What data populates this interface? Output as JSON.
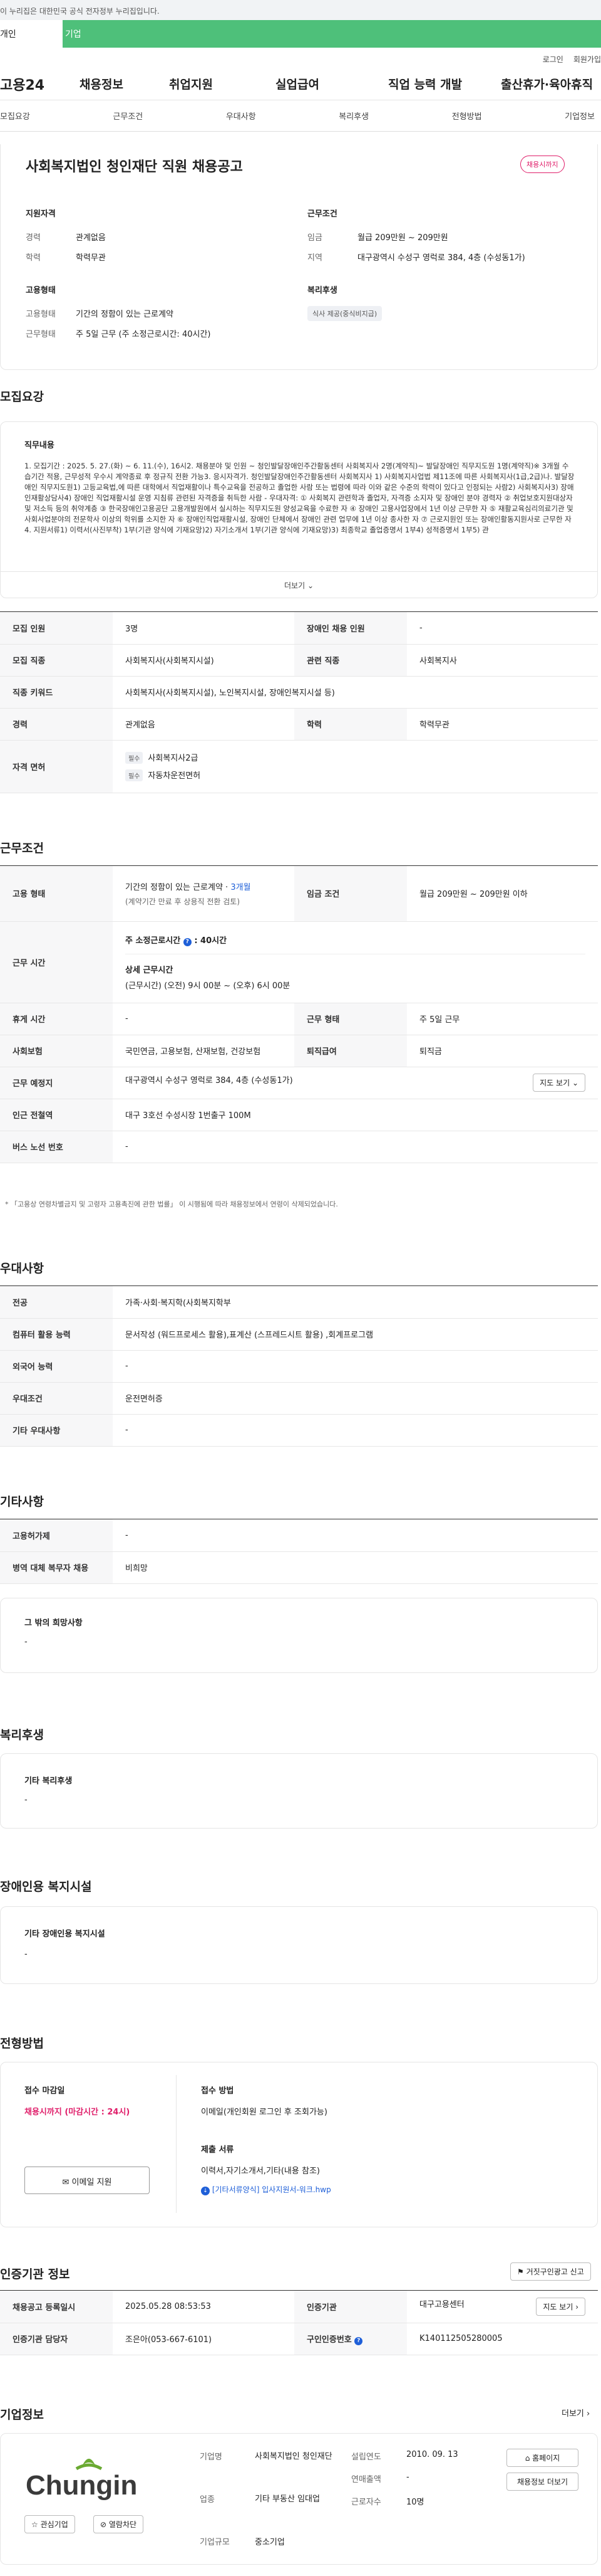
{
  "gov_notice": "이 누리집은 대한민국 공식 전자정부 누리집입니다.",
  "top_tabs": [
    "개인",
    "기업"
  ],
  "util": [
    "로그인",
    "회원가입"
  ],
  "gnb": {
    "logo": "고용24",
    "items": [
      "채용정보",
      "취업지원",
      "실업급여",
      "직업 능력 개발",
      "출산휴가·육아휴직"
    ]
  },
  "subnav": [
    "모집요강",
    "근무조건",
    "우대사항",
    "복리후생",
    "전형방법",
    "기업정보"
  ],
  "job": {
    "title": "사회복지법인 청인재단 직원 채용공고",
    "status": "채용시까지",
    "qual_h": "지원자격",
    "career_l": "경력",
    "career_v": "관계없음",
    "edu_l": "학력",
    "edu_v": "학력무관",
    "cond_h": "근무조건",
    "wage_l": "임금",
    "wage_v": "월급 209만원 ~ 209만원",
    "area_l": "지역",
    "area_v": "대구광역시 수성구 영럭로 384, 4층 (수성동1가)",
    "emp_h": "고용형태",
    "emp_l": "고용형태",
    "emp_v": "기간의 정함이 있는 근로계약",
    "hours_l": "근무형태",
    "hours_v": "주 5일 근무 (주 소정근로시간: 40시간)",
    "welfare_h": "복리후생",
    "welfare_tag": "식사 제공(중식비지급)"
  },
  "recruit": {
    "title": "모집요강",
    "content_h": "직무내용",
    "content": "1. 모집기간 : 2025. 5. 27.(화) ~ 6. 11.(수), 16시2. 채용분야 및 인원 ~ 청인발달장애인주간활동센터 사회복지사 2명(계약직)~ 발달장애인 직무지도원 1명(계약직)※ 3개월 수습기간 적용, 근무성적 우수시 계약종료 후 정규직 전환 가능3. 응시자격가. 청인발달장애인주간활동센터 사회복지사 1) 사회복지사업법 제11조에 따른 사회복지사(1급,2급)나. 발달장애인 직무지도원1) 고등교육법,에 따른 대학에서 직업재활이나 특수교육을 전공하고 졸업한 사람 또는 법령에 따라 이와 같은 수준의 학력이 있다고 인정되는 사람2) 사회복지사3) 장애인재활상담사4) 장애인 직업재활시설 운영 지침류 관련된 자격증을 취득한 사람 - 우대자격: ① 사회복지 관련학과 졸업자, 자격증 소지자 및 장애인 분야 경력자 ② 취업보호지원대상자 및 저소득 등의 취약계층 ③ 한국장애인고용공단 고용개발원에서 실시하는 직무지도원 양성교육을 수료한 자 ④ 장애인 고용사업장에서 1년 이상 근무한 자 ⑤ 재활교육심리의료기관 및 사회사업분야의 전문학사 이상의 학위를 소지한 자 ⑥ 장애인직업재활시설, 장애인 단체에서 장애인 관련 업무에 1년 이상 종사한 자 ⑦ 근로지원인 또는 장애인활동지원사로 근무한 자4. 지원서류1) 이력서(사진부착) 1부(기관 양식에 기재요망)2) 자기소개서 1부(기관 양식에 기재요망)3) 최종학교 졸업증명서 1부4) 성적증명서 1부5) 관",
    "more": "더보기",
    "rows": [
      {
        "l": "모집 인원",
        "v": "3명",
        "l2": "장애인 채용 인원",
        "v2": "-"
      },
      {
        "l": "모집 직종",
        "v": "사회복지사(사회복지시설)",
        "l2": "관련 직종",
        "v2": "사회복지사"
      },
      {
        "l": "직종 키워드",
        "v": "사회복지사(사회복지시설), 노인복지시설, 장애인복지시설 등)"
      },
      {
        "l": "경력",
        "v": "관계없음",
        "l2": "학력",
        "v2": "학력무관"
      }
    ],
    "license_l": "자격 면허",
    "lic_badge": "필수",
    "lic1": "사회복지사2급",
    "lic2": "자동차운전면허"
  },
  "cond": {
    "title": "근무조건",
    "emp_l": "고용 형태",
    "emp_v": "기간의 정함이 있는 근로계약 · ",
    "emp_v2": "3개월",
    "emp_sub": "(계약기간 만료 후 상용직 전환 검토)",
    "wage_l": "임금 조건",
    "wage_v": "월급 209만원 ~ 209만원 이하",
    "time_l": "근무 시간",
    "time_h": "주 소정근로시간",
    "time_v": ": 40시간",
    "time_d_h": "상세 근무시간",
    "time_d": "(근무시간) (오전) 9시 00분 ~ (오후) 6시 00분",
    "rest_l": "휴게 시간",
    "rest_v": "-",
    "type_l": "근무 형태",
    "type_v": "주 5일 근무",
    "ins_l": "사회보험",
    "ins_v": "국민연금, 고용보험, 산재보험, 건강보험",
    "ret_l": "퇴직급여",
    "ret_v": "퇴직금",
    "place_l": "근무 예정지",
    "place_v": "대구광역시 수성구 영럭로 384, 4층 (수성동1가)",
    "map_btn": "지도 보기",
    "sub_l": "인근 전철역",
    "sub_v": "대구 3호선 수성시장 1번출구 100M",
    "bus_l": "버스 노선 번호",
    "bus_v": "-",
    "note": "* 「고용상 연령차별금지 및 고령자 고용촉진에 관한 법률」 이 시행됨에 따라 채용정보에서 연령이 삭제되었습니다."
  },
  "pref": {
    "title": "우대사항",
    "rows": [
      [
        "전공",
        "가족·사회·복지학(사회복지학부"
      ],
      [
        "컴퓨터 활용 능력",
        "문서작성 (워드프로세스 활용),표계산 (스프레드시트 활용) ,회계프로그램"
      ],
      [
        "외국어 능력",
        "-"
      ],
      [
        "우대조건",
        "운전면허증"
      ],
      [
        "기타 우대사항",
        "-"
      ]
    ]
  },
  "etc": {
    "title": "기타사항",
    "rows": [
      [
        "고용허가제",
        "-"
      ],
      [
        "병역 대체 복무자 채용",
        "비희망"
      ]
    ],
    "other_h": "그 밖의 희망사항",
    "other_v": "-"
  },
  "welfare": {
    "title": "복리후생",
    "h": "기타 복리후생",
    "v": "-"
  },
  "disab": {
    "title": "장애인용 복지시설",
    "h": "기타 장애인용 복지시설",
    "v": "-"
  },
  "process": {
    "title": "전형방법",
    "deadline_h": "접수 마감일",
    "deadline_v": "채용시까지 (마감시간 : 24시)",
    "apply_btn": "이메일 지원",
    "method_h": "접수 방법",
    "method_v": "이메일(개인회원 로그인 후 조회가능)",
    "docs_h": "제출 서류",
    "docs_v": "이력서,자기소개서,기타(내용 참조)",
    "file": "[기타서류양식] 입사지원서-워크.hwp"
  },
  "cert": {
    "title": "인증기관 정보",
    "report_btn": "거짓구인광고 신고",
    "reg_l": "채용공고 등록일시",
    "reg_v": "2025.05.28 08:53:53",
    "org_l": "인증기관",
    "org_v": "대구고용센터",
    "map_btn": "지도 보기",
    "mgr_l": "인증기관 담당자",
    "mgr_v": "조은아(053-667-6101)",
    "no_l": "구인인증번호",
    "no_v": "K140112505280005"
  },
  "company": {
    "title": "기업정보",
    "more": "더보기",
    "logo": "Chungin",
    "fav": "관심기업",
    "block": "열람차단",
    "type_l": "기업명",
    "type_v": "사회복지법인 청인재단",
    "ind_l": "업종",
    "ind_v": "기타 부동산 임대업",
    "size_l": "기업규모",
    "size_v": "중소기업",
    "est_l": "설립연도",
    "est_v": "2010. 09. 13",
    "sales_l": "연매출액",
    "sales_v": "-",
    "emp_l": "근로자수",
    "emp_v": "10명",
    "home_btn": "홈페이지",
    "jobs_btn": "채용정보 더보기"
  },
  "colors": {
    "accent": "#1e5fd8",
    "brand": "#4ec07a",
    "deadline": "#e0206b",
    "logo_green": "#6aaa32"
  }
}
